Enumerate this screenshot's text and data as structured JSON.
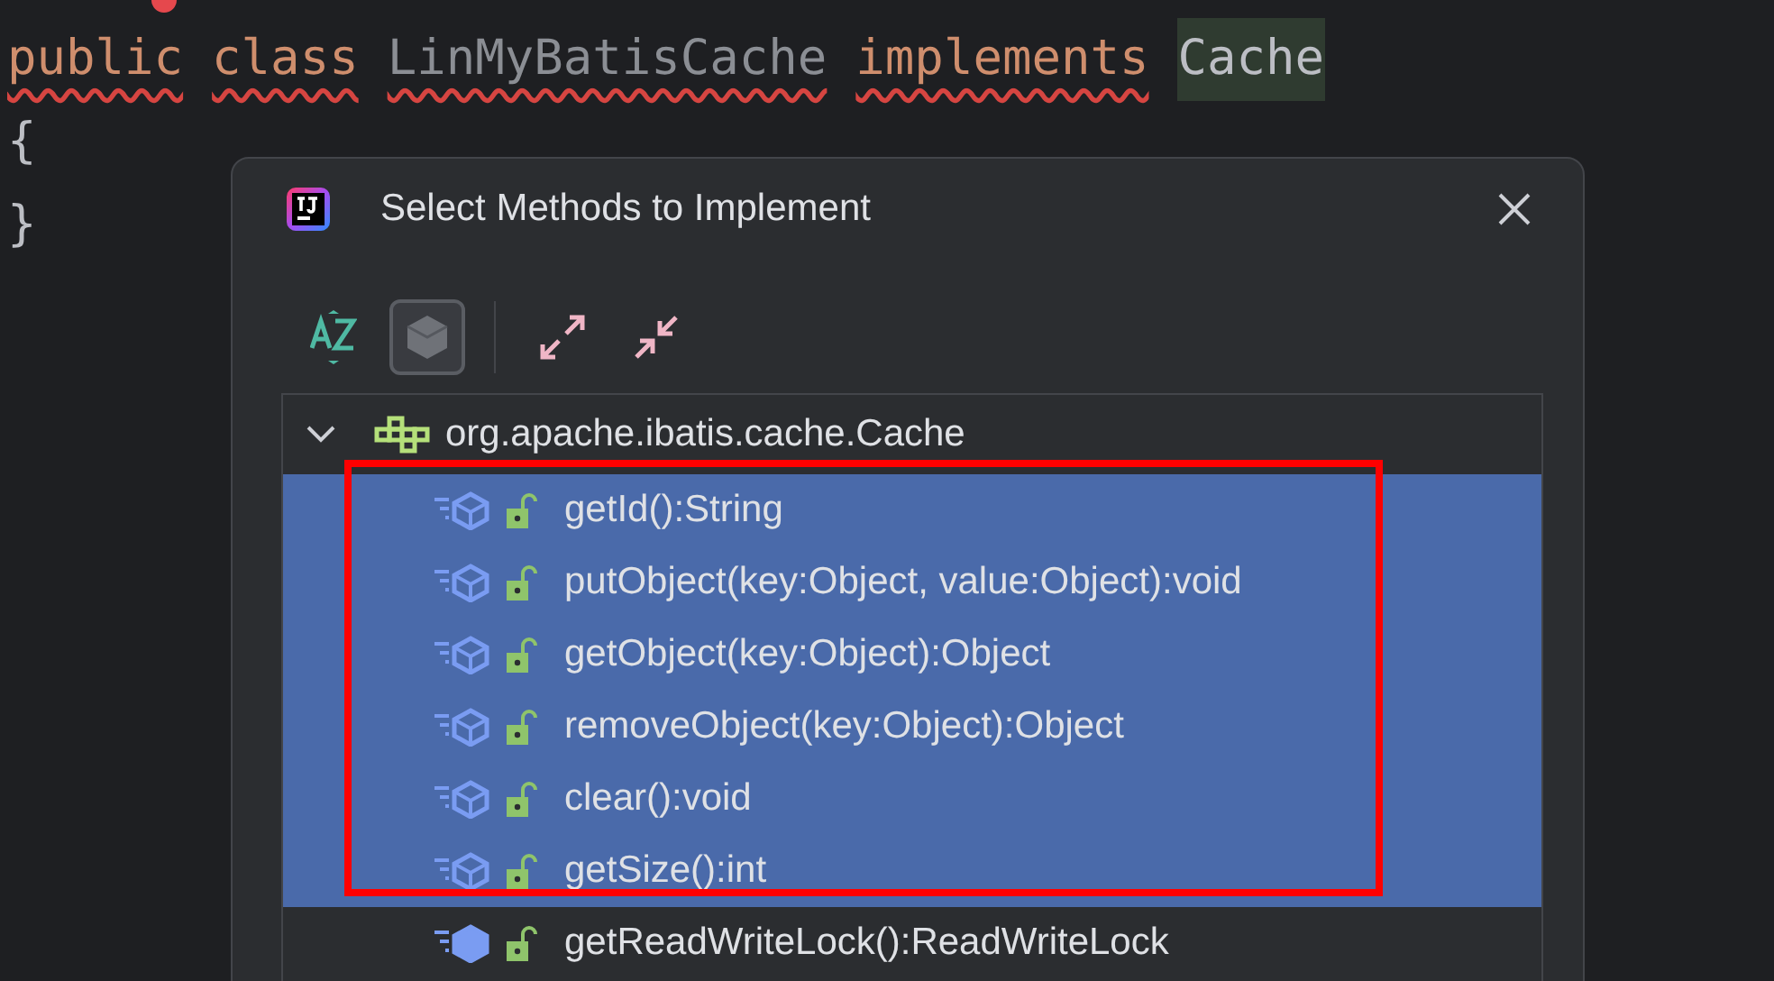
{
  "editor": {
    "lines": [
      {
        "tokens": [
          {
            "text": "public",
            "kind": "keyword",
            "error": true
          },
          {
            "text": "class",
            "kind": "keyword",
            "error": true
          },
          {
            "text": "LinMyBatisCache",
            "kind": "name",
            "error": true
          },
          {
            "text": "implements",
            "kind": "keyword",
            "error": true
          },
          {
            "text": "Cache",
            "kind": "reference",
            "error": false
          }
        ]
      },
      {
        "tokens": [
          {
            "text": "{",
            "kind": "brace",
            "error": false
          }
        ]
      },
      {
        "tokens": [
          {
            "text": "}",
            "kind": "brace",
            "error": false
          }
        ]
      }
    ]
  },
  "dialog": {
    "title": "Select Methods to Implement",
    "toolbar": [
      {
        "kind": "sort",
        "selected": false
      },
      {
        "kind": "interfaces",
        "selected": true
      },
      {
        "kind": "expand",
        "selected": false
      },
      {
        "kind": "collapse",
        "selected": false
      }
    ],
    "tree": {
      "label": "org.apache.ibatis.cache.Cache",
      "expanded": true,
      "children": [
        {
          "label": "getId():String",
          "kind": "abstract",
          "selected": true
        },
        {
          "label": "putObject(key:Object, value:Object):void",
          "kind": "abstract",
          "selected": true
        },
        {
          "label": "getObject(key:Object):Object",
          "kind": "abstract",
          "selected": true
        },
        {
          "label": "removeObject(key:Object):Object",
          "kind": "abstract",
          "selected": true
        },
        {
          "label": "clear():void",
          "kind": "abstract",
          "selected": true
        },
        {
          "label": "getSize():int",
          "kind": "abstract",
          "selected": true
        },
        {
          "label": "getReadWriteLock():ReadWriteLock",
          "kind": "default",
          "selected": false
        }
      ]
    }
  }
}
